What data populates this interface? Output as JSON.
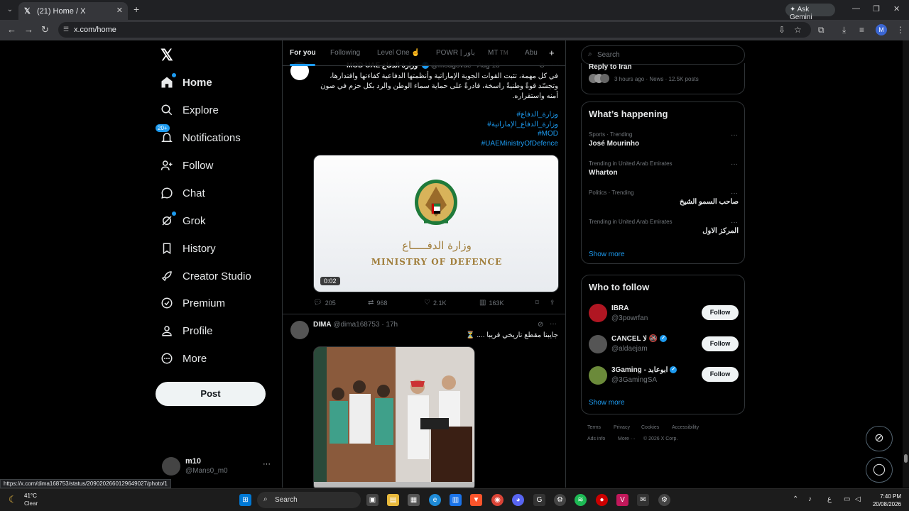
{
  "browser": {
    "tab_title": "(21) Home / X",
    "url": "x.com/home",
    "ask_gemini": "Ask Gemini",
    "profile_initial": "M",
    "status_url": "https://x.com/dima168753/status/2090202660129649027/photo/1"
  },
  "nav": {
    "items": [
      {
        "label": "Home"
      },
      {
        "label": "Explore"
      },
      {
        "label": "Notifications",
        "badge": "20+"
      },
      {
        "label": "Follow"
      },
      {
        "label": "Chat"
      },
      {
        "label": "Grok"
      },
      {
        "label": "History"
      },
      {
        "label": "Creator Studio"
      },
      {
        "label": "Premium"
      },
      {
        "label": "Profile"
      },
      {
        "label": "More"
      }
    ],
    "post_label": "Post",
    "account": {
      "name": "m10",
      "handle": "@Mans0_m0"
    }
  },
  "feed": {
    "tabs": [
      {
        "label": "For you"
      },
      {
        "label": "Following"
      },
      {
        "label": "Level One ☝"
      },
      {
        "label": "POWR | باور"
      },
      {
        "label": "MT"
      },
      {
        "label": "TM"
      },
      {
        "label": "Abu"
      }
    ],
    "tweet1": {
      "author_name": "MOD UAE وزارة الدفاع",
      "handle": "@modgovae",
      "time": "Aug 18",
      "text": "في كل مهمة، تثبت القوات الجوية الإماراتية وأنظمتها الدفاعية كفاءتها واقتدارها، وتجسّد قوةً وطنيةً راسخة، قادرةً على حماية سماء الوطن والرد بكل حزم في صون أمنه واستقراره.",
      "hashtags": [
        "#وزارة_الدفاع",
        "#وزارة_الدفاع_الإماراتية",
        "#MOD",
        "#UAEMinistryOfDefence"
      ],
      "video_ar": "وزارة الدفـــــاع",
      "video_en": "MINISTRY OF DEFENCE",
      "video_duration": "0:02",
      "replies": "205",
      "reposts": "968",
      "likes": "2.1K",
      "views": "163K"
    },
    "tweet2": {
      "author_name": "DIMA",
      "handle": "@dima168753",
      "time": "17h",
      "text": "جايبنا مقطع تاريخي قريبا .... ⏳"
    }
  },
  "right": {
    "search_placeholder": "Search",
    "news": {
      "title": "Reply to Iran",
      "meta": "3 hours ago · News · 12.5K posts"
    },
    "happening_title": "What’s happening",
    "trends": [
      {
        "meta": "Sports · Trending",
        "name": "José Mourinho"
      },
      {
        "meta": "Trending in United Arab Emirates",
        "name": "Wharton"
      },
      {
        "meta": "Politics · Trending",
        "name": "صاحب السمو الشيخ"
      },
      {
        "meta": "Trending in United Arab Emirates",
        "name": "المركز الاول"
      }
    ],
    "show_more": "Show more",
    "wtf_title": "Who to follow",
    "who_to_follow": [
      {
        "name": "IBRA",
        "handle": "@3powrfan",
        "follow": "Follow"
      },
      {
        "name": "CANCEL ﻻ 🚳",
        "handle": "@aldaejam",
        "follow": "Follow"
      },
      {
        "name": "3Gaming - ابوعابد",
        "handle": "@3GamingSA",
        "follow": "Follow"
      }
    ],
    "footer": [
      "Terms",
      "Privacy",
      "Cookies",
      "Accessibility",
      "Ads info",
      "More ···",
      "© 2026 X Corp."
    ]
  },
  "taskbar": {
    "weather_temp": "41°C",
    "weather_cond": "Clear",
    "search_label": "Search",
    "lang": "ع",
    "time": "7:40 PM",
    "date": "20/08/2026"
  },
  "colors": {
    "accent": "#1d9bf0",
    "background": "#000000",
    "border": "#2f3336",
    "muted": "#71767b"
  }
}
